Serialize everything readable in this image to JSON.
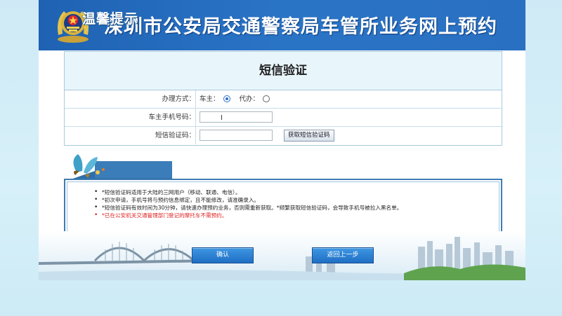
{
  "header": {
    "title": "深圳市公安局交通警察局车管所业务网上预约"
  },
  "panel": {
    "title": "短信验证",
    "rows": [
      {
        "label": "办理方式：",
        "options": [
          {
            "label": "车主：",
            "selected": true
          },
          {
            "label": "代办：",
            "selected": false
          }
        ]
      },
      {
        "label": "车主手机号码：",
        "value": ""
      },
      {
        "label": "短信验证码：",
        "value": "",
        "button": "获取短信验证码"
      }
    ]
  },
  "tips": {
    "title": "温馨提示",
    "items": [
      "*短信验证码适用于大陆的三网用户（移动、联通、电信）。",
      "*初次申请，手机号将与预约信息绑定，且不能修改，请准确录入。",
      "*短信验证码有效时间为30分钟，请快速办理预约业务，否则需重新获取。*频繁获取短信验证码，会导致手机号被拉入黑名单。",
      "*已在公安机关交通管理部门登记的摩托车不需预约。"
    ]
  },
  "buttons": {
    "confirm": "确认",
    "back": "返回上一步"
  },
  "colors": {
    "header": "#2a70c2",
    "accent": "#1f6fc4",
    "warning": "#e02020"
  }
}
